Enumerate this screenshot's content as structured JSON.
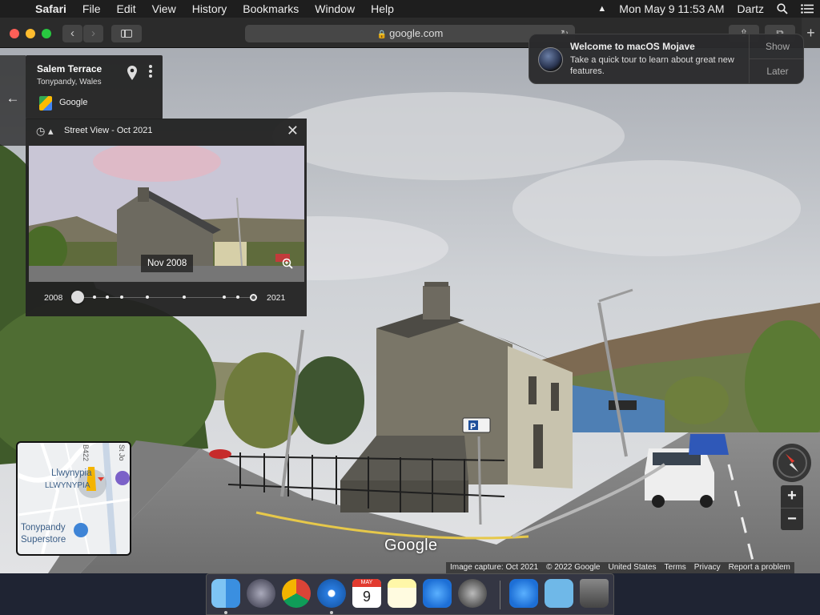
{
  "menubar": {
    "app_name": "Safari",
    "items": [
      "File",
      "Edit",
      "View",
      "History",
      "Bookmarks",
      "Window",
      "Help"
    ],
    "datetime": "Mon May 9  11:53 AM",
    "user": "Dartz"
  },
  "toolbar": {
    "url": "google.com"
  },
  "notification": {
    "title": "Welcome to macOS Mojave",
    "body": "Take a quick tour to learn about great new features.",
    "show_label": "Show",
    "later_label": "Later"
  },
  "place_card": {
    "title": "Salem Terrace",
    "subtitle": "Tonypandy, Wales",
    "source": "Google"
  },
  "time_machine": {
    "title": "Street View - Oct 2021",
    "preview_date": "Nov 2008",
    "start_year": "2008",
    "end_year": "2021"
  },
  "minimap": {
    "labels": [
      "Llwynypia",
      "LLWYNYPIA",
      "Tonypandy",
      "Superstore"
    ],
    "road_labels": [
      "B422",
      "St Jo"
    ]
  },
  "scene": {
    "road_sign": "P"
  },
  "footer": {
    "wordmark": "Google",
    "links": [
      "Image capture: Oct 2021",
      "© 2022 Google",
      "United States",
      "Terms",
      "Privacy",
      "Report a problem"
    ]
  },
  "dock": {
    "calendar_month": "MAY",
    "calendar_day": "9"
  },
  "colors": {
    "menubar_bg": "#1e1e1e",
    "toolbar_bg": "#2b2b2b",
    "panel_bg": "#222222",
    "close": "#fe5f57",
    "minimize": "#febc2e",
    "maximize": "#28c840"
  },
  "icons": {
    "apple": "apple-icon",
    "history": "history-icon",
    "close": "close-icon",
    "pin": "location-pin-icon",
    "more": "more-vertical-icon",
    "zoom": "zoom-in-icon"
  }
}
